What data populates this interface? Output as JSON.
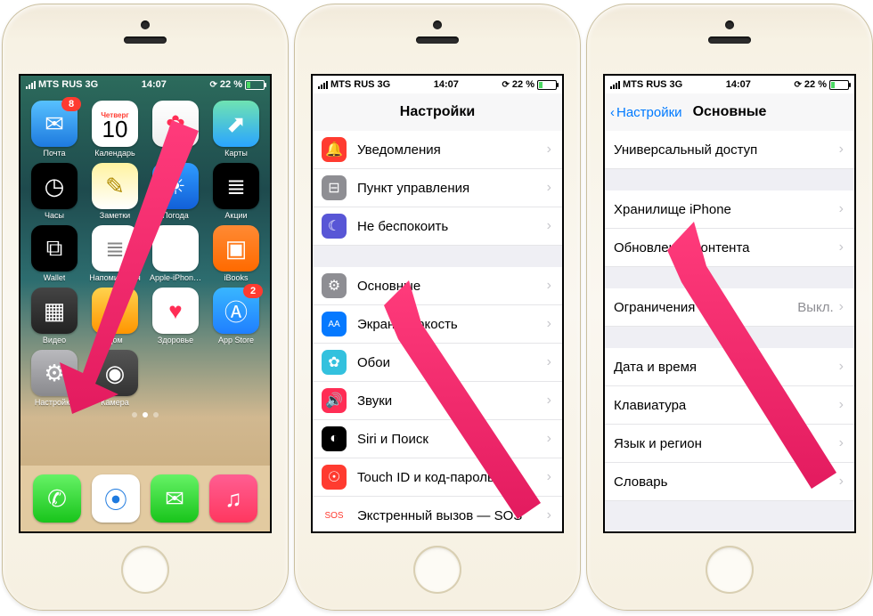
{
  "statusbar": {
    "carrier": "MTS RUS",
    "network": "3G",
    "time": "14:07",
    "battery_pct": "22 %"
  },
  "calendar": {
    "weekday": "Четверг",
    "day": "10"
  },
  "homeapps": [
    {
      "label": "Почта",
      "emoji": "✉︎",
      "bg": "linear-gradient(180deg,#57c1ff,#1e7adf)",
      "badge": "8"
    },
    {
      "label": "Календарь",
      "cal": true
    },
    {
      "label": "Фото",
      "emoji": "✿",
      "bg": "linear-gradient(180deg,#fff,#eee)",
      "color": "#ff2d55"
    },
    {
      "label": "Карты",
      "emoji": "⬈",
      "bg": "linear-gradient(180deg,#6fe3b2,#2aa5ff)"
    },
    {
      "label": "Часы",
      "emoji": "◷",
      "bg": "#000"
    },
    {
      "label": "Заметки",
      "emoji": "✎",
      "bg": "linear-gradient(180deg,#fff3a0,#fff)",
      "color": "#af8a00"
    },
    {
      "label": "Погода",
      "emoji": "☀︎",
      "bg": "linear-gradient(180deg,#2f9cff,#1260d8)"
    },
    {
      "label": "Акции",
      "emoji": "≣",
      "bg": "#000"
    },
    {
      "label": "Wallet",
      "emoji": "⧉",
      "bg": "#000"
    },
    {
      "label": "Напоминания",
      "emoji": "≣",
      "bg": "#fff",
      "color": "#888"
    },
    {
      "label": "Apple-iPhon…",
      "emoji": "",
      "bg": "#fff"
    },
    {
      "label": "iBooks",
      "emoji": "▣",
      "bg": "linear-gradient(180deg,#ff8a34,#ff6a00)"
    },
    {
      "label": "Видео",
      "emoji": "▦",
      "bg": "linear-gradient(180deg,#444,#222)"
    },
    {
      "label": "Дом",
      "emoji": "⌂",
      "bg": "linear-gradient(180deg,#ffd24d,#ff9500)"
    },
    {
      "label": "Здоровье",
      "emoji": "♥︎",
      "bg": "#fff",
      "color": "#ff2d55"
    },
    {
      "label": "App Store",
      "emoji": "Ⓐ",
      "bg": "linear-gradient(180deg,#39b6ff,#1f7fff)",
      "badge": "2"
    },
    {
      "label": "Настройки",
      "emoji": "⚙︎",
      "bg": "linear-gradient(180deg,#b9b9bd,#89898d)"
    },
    {
      "label": "Камера",
      "emoji": "◉",
      "bg": "linear-gradient(180deg,#555,#333)"
    }
  ],
  "dock": [
    {
      "name": "phone",
      "emoji": "✆",
      "bg": "linear-gradient(180deg,#66f266,#18c41b)"
    },
    {
      "name": "safari",
      "emoji": "⦿",
      "bg": "#fff",
      "color": "#1e7adf"
    },
    {
      "name": "messages",
      "emoji": "✉︎",
      "bg": "linear-gradient(180deg,#66f266,#18c41b)"
    },
    {
      "name": "music",
      "emoji": "♫",
      "bg": "linear-gradient(180deg,#ff5e92,#ff375f)"
    }
  ],
  "settings": {
    "title": "Настройки",
    "rows": [
      {
        "icon": "🔔",
        "bg": "#ff3b30",
        "label": "Уведомления"
      },
      {
        "icon": "⊟",
        "bg": "#8e8e93",
        "label": "Пункт управления"
      },
      {
        "icon": "☾",
        "bg": "#5856d6",
        "label": "Не беспокоить"
      },
      {
        "gap": true
      },
      {
        "icon": "⚙︎",
        "bg": "#8e8e93",
        "label": "Основные"
      },
      {
        "icon": "AA",
        "bg": "#0579ff",
        "label": "Экран и яркость",
        "small": true
      },
      {
        "icon": "✿",
        "bg": "#33c1de",
        "label": "Обои"
      },
      {
        "icon": "🔊",
        "bg": "#ff2d55",
        "label": "Звуки"
      },
      {
        "icon": "◐",
        "bg": "#000",
        "label": "Siri и Поиск"
      },
      {
        "icon": "☉",
        "bg": "#ff3b30",
        "label": "Touch ID и код-пароль"
      },
      {
        "icon": "SOS",
        "bg": "#fff",
        "label": "Экстренный вызов — SOS",
        "small": true,
        "color": "#ff3b30"
      }
    ]
  },
  "general": {
    "back": "Настройки",
    "title": "Основные",
    "rows": [
      {
        "label": "Универсальный доступ"
      },
      {
        "gap": true
      },
      {
        "label": "Хранилище iPhone"
      },
      {
        "label": "Обновление контента"
      },
      {
        "gap": true
      },
      {
        "label": "Ограничения",
        "value": "Выкл."
      },
      {
        "gap": true
      },
      {
        "label": "Дата и время"
      },
      {
        "label": "Клавиатура"
      },
      {
        "label": "Язык и регион"
      },
      {
        "label": "Словарь"
      },
      {
        "gap": true
      }
    ]
  }
}
